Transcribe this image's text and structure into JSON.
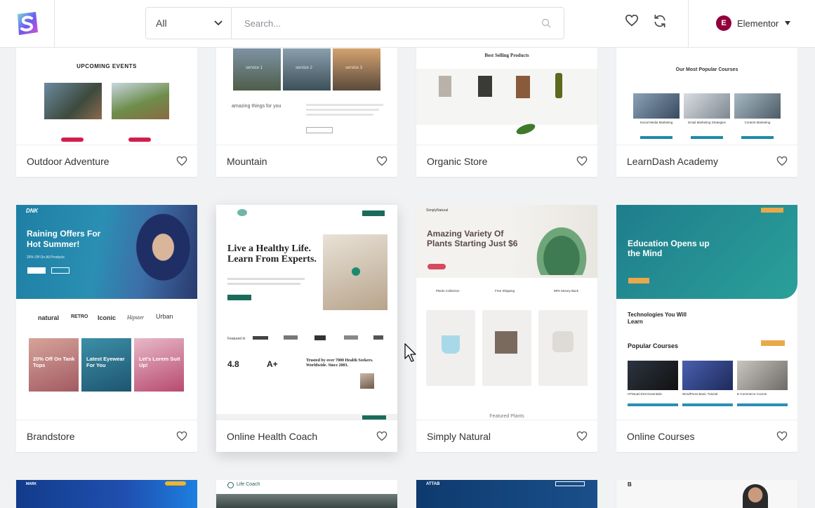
{
  "header": {
    "category_selected": "All",
    "search_placeholder": "Search...",
    "builder_name": "Elementor",
    "builder_logo_letter": "E"
  },
  "colors": {
    "accent_red": "#d21e4a",
    "teal": "#1f7d8c",
    "health_green": "#1c6b5a",
    "elementor": "#92003b"
  },
  "cards": [
    {
      "title": "Outdoor Adventure",
      "preview_heading": "UPCOMING EVENTS"
    },
    {
      "title": "Mountain",
      "preview_text": "amazing things for you",
      "preview_labels": [
        "service 1",
        "service 2",
        "service 3"
      ]
    },
    {
      "title": "Organic Store",
      "preview_heading": "Best Selling Products"
    },
    {
      "title": "LearnDash Academy",
      "preview_heading": "Our Most Popular Courses",
      "preview_labels": [
        "Social Media Marketing",
        "Email Marketing Strategies",
        "Content Marketing"
      ]
    },
    {
      "title": "Brandstore",
      "brand": "DNK",
      "hero": "Raining Offers For Hot Summer!",
      "sub": "25% Off On All Products",
      "logos": [
        "natural",
        "RETRO",
        "Iconic",
        "Hipster",
        "Urban"
      ],
      "promos": [
        "20% Off On Tank Tops",
        "Latest Eyewear For You",
        "Let's Lorem Suit Up!"
      ]
    },
    {
      "title": "Online Health Coach",
      "hero": "Live a Healthy Life. Learn From Experts.",
      "stat1": "4.8",
      "stat2": "A+",
      "quote": "Trusted by over 7000 Health Seekers. Worldwide. Since 2003.",
      "featured": "Featured In"
    },
    {
      "title": "Simply Natural",
      "brand": "SimplyNatural",
      "hero": "Amazing Variety Of Plants Starting Just $6",
      "features": [
        "Plants Collection",
        "Free Shipping",
        "99% Money Back"
      ],
      "footer_text": "Featured Plants"
    },
    {
      "title": "Online Courses",
      "hero": "Education Opens up the Mind",
      "section1": "Technologies You Will Learn",
      "section2": "Popular Courses",
      "courses": [
        "HTML&CSS3 Essentials",
        "WordPress Basic Tutorial",
        "E-Commerce Course"
      ]
    }
  ],
  "bottom_cards": [
    {
      "brand": "MARK"
    },
    {
      "brand": "Life Coach"
    },
    {
      "brand": "ATTAB"
    },
    {
      "brand": "B"
    }
  ]
}
